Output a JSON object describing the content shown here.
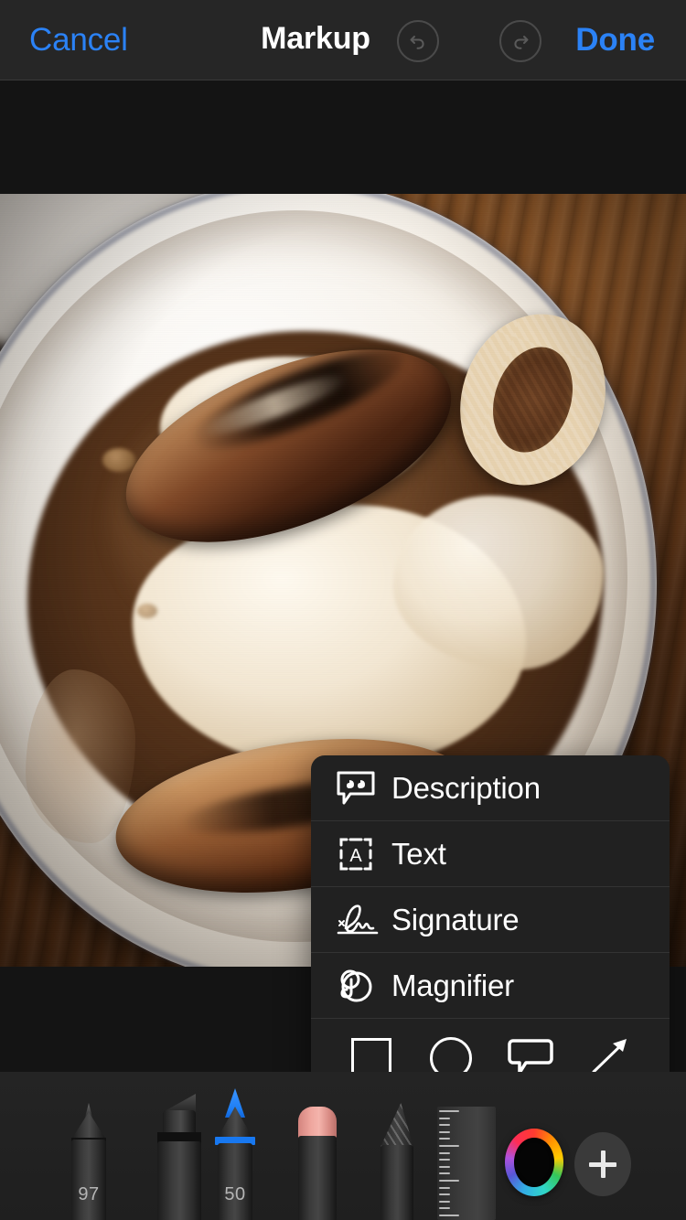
{
  "navbar": {
    "cancel_label": "Cancel",
    "title": "Markup",
    "done_label": "Done",
    "undo_icon": "undo-arrow-icon",
    "redo_icon": "redo-arrow-icon",
    "undo_enabled": "false",
    "redo_enabled": "false",
    "tint_color": "#2b82f6"
  },
  "photo": {
    "alt": "Bangers and mash — grilled sausages with mashed potato, gravy and an onion ring in a white bowl on a wooden table"
  },
  "context_menu": {
    "items": [
      {
        "label": "Description",
        "icon": "speech-bubble-quote-icon"
      },
      {
        "label": "Text",
        "icon": "text-box-a-icon"
      },
      {
        "label": "Signature",
        "icon": "signature-icon"
      },
      {
        "label": "Magnifier",
        "icon": "magnifier-loupe-icon"
      }
    ],
    "shapes": [
      {
        "name": "square",
        "icon": "square-shape-icon"
      },
      {
        "name": "circle",
        "icon": "circle-shape-icon"
      },
      {
        "name": "callout",
        "icon": "speech-bubble-shape-icon"
      },
      {
        "name": "arrow",
        "icon": "arrow-shape-icon"
      }
    ]
  },
  "tool_tray": {
    "tools": [
      {
        "name": "pen",
        "size": "97",
        "selected": "false"
      },
      {
        "name": "highlighter",
        "size": "",
        "selected": "false"
      },
      {
        "name": "marker-pen",
        "size": "50",
        "selected": "true",
        "accent": "#1878f0"
      },
      {
        "name": "eraser",
        "size": "",
        "selected": "false",
        "accent": "#f4b4ac"
      },
      {
        "name": "pencil",
        "size": "",
        "selected": "false"
      },
      {
        "name": "ruler",
        "size": "",
        "selected": "false"
      }
    ],
    "color_swatch": "#050505",
    "add_label": "+"
  }
}
